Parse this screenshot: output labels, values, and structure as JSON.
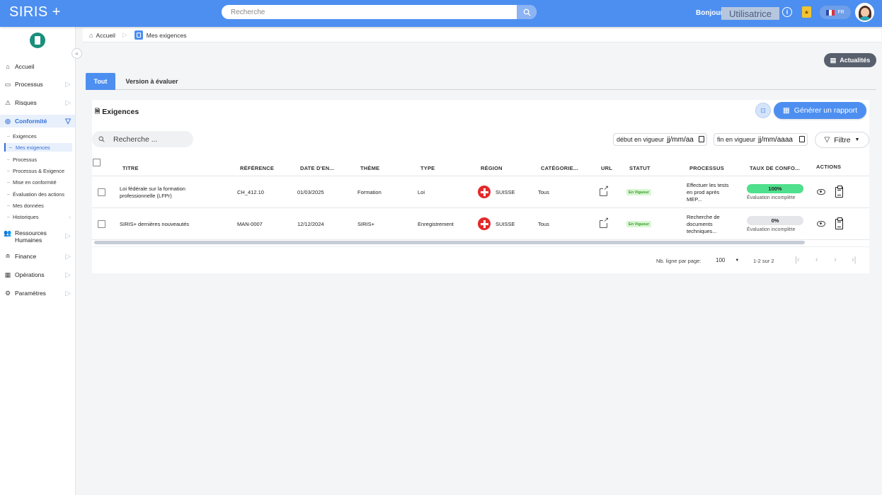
{
  "app": {
    "brand": "SIRIS +"
  },
  "header": {
    "search_placeholder": "Recherche",
    "greeting": "Bonjour,",
    "username": "Utilisatrice",
    "lang": "FR"
  },
  "sidebar": {
    "items": [
      {
        "label": "Accueil",
        "icon": "home-icon"
      },
      {
        "label": "Processus",
        "icon": "process-icon"
      },
      {
        "label": "Risques",
        "icon": "warning-icon"
      },
      {
        "label": "Conformité",
        "icon": "compliance-icon"
      },
      {
        "label": "Ressources Humaines",
        "icon": "people-icon"
      },
      {
        "label": "Finance",
        "icon": "money-icon"
      },
      {
        "label": "Opérations",
        "icon": "calendar-icon"
      },
      {
        "label": "Paramètres",
        "icon": "gear-icon"
      }
    ],
    "sub_items": [
      "Exigences",
      "Mes exigences",
      "Processus",
      "Processus & Exigence",
      "Mise en conformité",
      "Évaluation des actions",
      "Mes données",
      "Historiques"
    ]
  },
  "breadcrumb": {
    "home": "Accueil",
    "current": "Mes exigences"
  },
  "news_button": "Actualités",
  "tabs": [
    "Tout",
    "Version à évaluer"
  ],
  "card": {
    "title": "Exigences",
    "report_button": "Générer un rapport",
    "search_placeholder": "Recherche ...",
    "date_start_label": "début en vigueur",
    "date_start_value": "jj/mm/aa",
    "date_end_label": "fin en vigueur",
    "date_end_value": "jj/mm/aaaa",
    "filter_button": "Filtre"
  },
  "table": {
    "headers": [
      "TITRE",
      "RÉFÉRENCE",
      "DATE D'EN...",
      "THÈME",
      "TYPE",
      "RÉGION",
      "CATÉGORIE...",
      "URL",
      "STATUT",
      "PROCESSUS",
      "TAUX DE CONFO...",
      "ACTIONS"
    ],
    "rows": [
      {
        "title_line1": "Loi fédérale sur la formation",
        "title_line2": "professionnelle (LFPr)",
        "reference": "CH_412.10",
        "date": "01/03/2025",
        "theme": "Formation",
        "type": "Loi",
        "region": "SUISSE",
        "category": "Tous",
        "status": "En Vigueur",
        "process_line1": "Effectuer les tests",
        "process_line2": "en prod après",
        "process_line3": "MEP...",
        "rate_label": "100%",
        "rate_value": 100,
        "rate_note": "Évaluation incomplète"
      },
      {
        "title_line1": "SIRIS+ dernières nouveautés",
        "title_line2": "",
        "reference": "MAN-0007",
        "date": "12/12/2024",
        "theme": "SIRIS+",
        "type": "Enregistrement",
        "region": "SUISSE",
        "category": "Tous",
        "status": "En Vigueur",
        "process_line1": "Recherche de",
        "process_line2": "documents",
        "process_line3": "techniques...",
        "rate_label": "0%",
        "rate_value": 0,
        "rate_note": "Évaluation incomplète"
      }
    ]
  },
  "pagination": {
    "rows_label": "Nb. ligne par page:",
    "rows_value": "100",
    "range": "1-2 sur 2"
  },
  "colors": {
    "primary": "#4d8ff0",
    "status_green": "#3a9a2a",
    "progress_green": "#4ee08c",
    "swiss_red": "#e32a2a"
  }
}
